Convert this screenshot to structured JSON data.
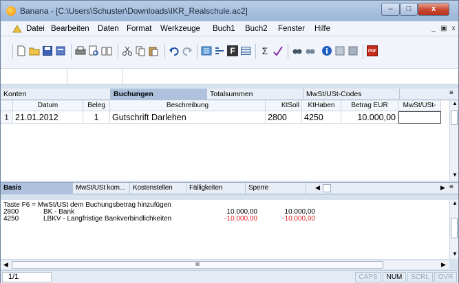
{
  "window": {
    "title": "Banana - [C:\\Users\\Schuster\\Downloads\\IKR_Realschule.ac2]",
    "controls": {
      "minimize": "–",
      "maximize": "□",
      "close": "x"
    }
  },
  "menu": {
    "items": [
      "Datei",
      "Bearbeiten",
      "Daten",
      "Format",
      "Werkzeuge",
      "Buch1",
      "Buch2",
      "Fenster",
      "Hilfe"
    ],
    "mdi": {
      "minimize": "_",
      "restore": "▣",
      "close": "x"
    }
  },
  "toolbar": {
    "icons": [
      "new-document-icon",
      "open-folder-icon",
      "save-icon",
      "properties-icon",
      "print-icon",
      "print-preview-icon",
      "book-icon",
      "cut-icon",
      "copy-icon",
      "paste-icon",
      "undo-icon",
      "redo-icon",
      "sort-icon",
      "indent-icon",
      "bold-icon",
      "table-icon",
      "sum-icon",
      "spellcheck-icon",
      "find-icon",
      "find-next-icon",
      "info-icon",
      "check-icon",
      "recheck-icon",
      "pdf-icon"
    ],
    "sum_symbol": "Σ",
    "bold_symbol": "F",
    "pdf_text": "PDF"
  },
  "tabs_top": [
    {
      "label": "Konten",
      "active": false
    },
    {
      "label": "Buchungen",
      "active": true
    },
    {
      "label": "Totalsummen",
      "active": false
    },
    {
      "label": "MwSt/USt-Codes",
      "active": false
    }
  ],
  "grid": {
    "columns": [
      "Datum",
      "Beleg",
      "Beschreibung",
      "KtSoll",
      "KtHaben",
      "Betrag EUR",
      "MwSt/USt-"
    ],
    "rows": [
      {
        "num": "1",
        "datum": "21.01.2012",
        "beleg": "1",
        "beschreibung": "Gutschrift Darlehen",
        "ktsoll": "2800",
        "kthaben": "4250",
        "betrag": "10.000,00",
        "mwst": ""
      }
    ]
  },
  "tabs_bottom": [
    {
      "label": "Basis",
      "active": true
    },
    {
      "label": "MwSt/USt kom...",
      "active": false
    },
    {
      "label": "Kostenstellen",
      "active": false
    },
    {
      "label": "Fälligkeiten",
      "active": false
    },
    {
      "label": "Sperre",
      "active": false
    }
  ],
  "info": {
    "hint": "Taste F6 = MwSt/USt dem Buchungsbetrag hinzufügen",
    "lines": [
      {
        "account": "2800",
        "description": "BK - Bank",
        "amount1": "10.000,00",
        "amount2": "10.000,00",
        "negative": false
      },
      {
        "account": "4250",
        "description": "LBKV - Langfristige Bankverbindlichkeiten",
        "amount1": "-10.000,00",
        "amount2": "-10.000,00",
        "negative": true
      }
    ]
  },
  "scrollbar": {
    "grip": "III"
  },
  "status": {
    "position": "1/1",
    "indicators": [
      {
        "label": "CAPS",
        "active": false
      },
      {
        "label": "NUM",
        "active": true
      },
      {
        "label": "SCRL",
        "active": false
      },
      {
        "label": "OVR",
        "active": false
      }
    ]
  },
  "colors": {
    "accent": "#aec2de",
    "negative": "#e02020",
    "titlebar": "#a6bedd",
    "close": "#c9452d"
  }
}
